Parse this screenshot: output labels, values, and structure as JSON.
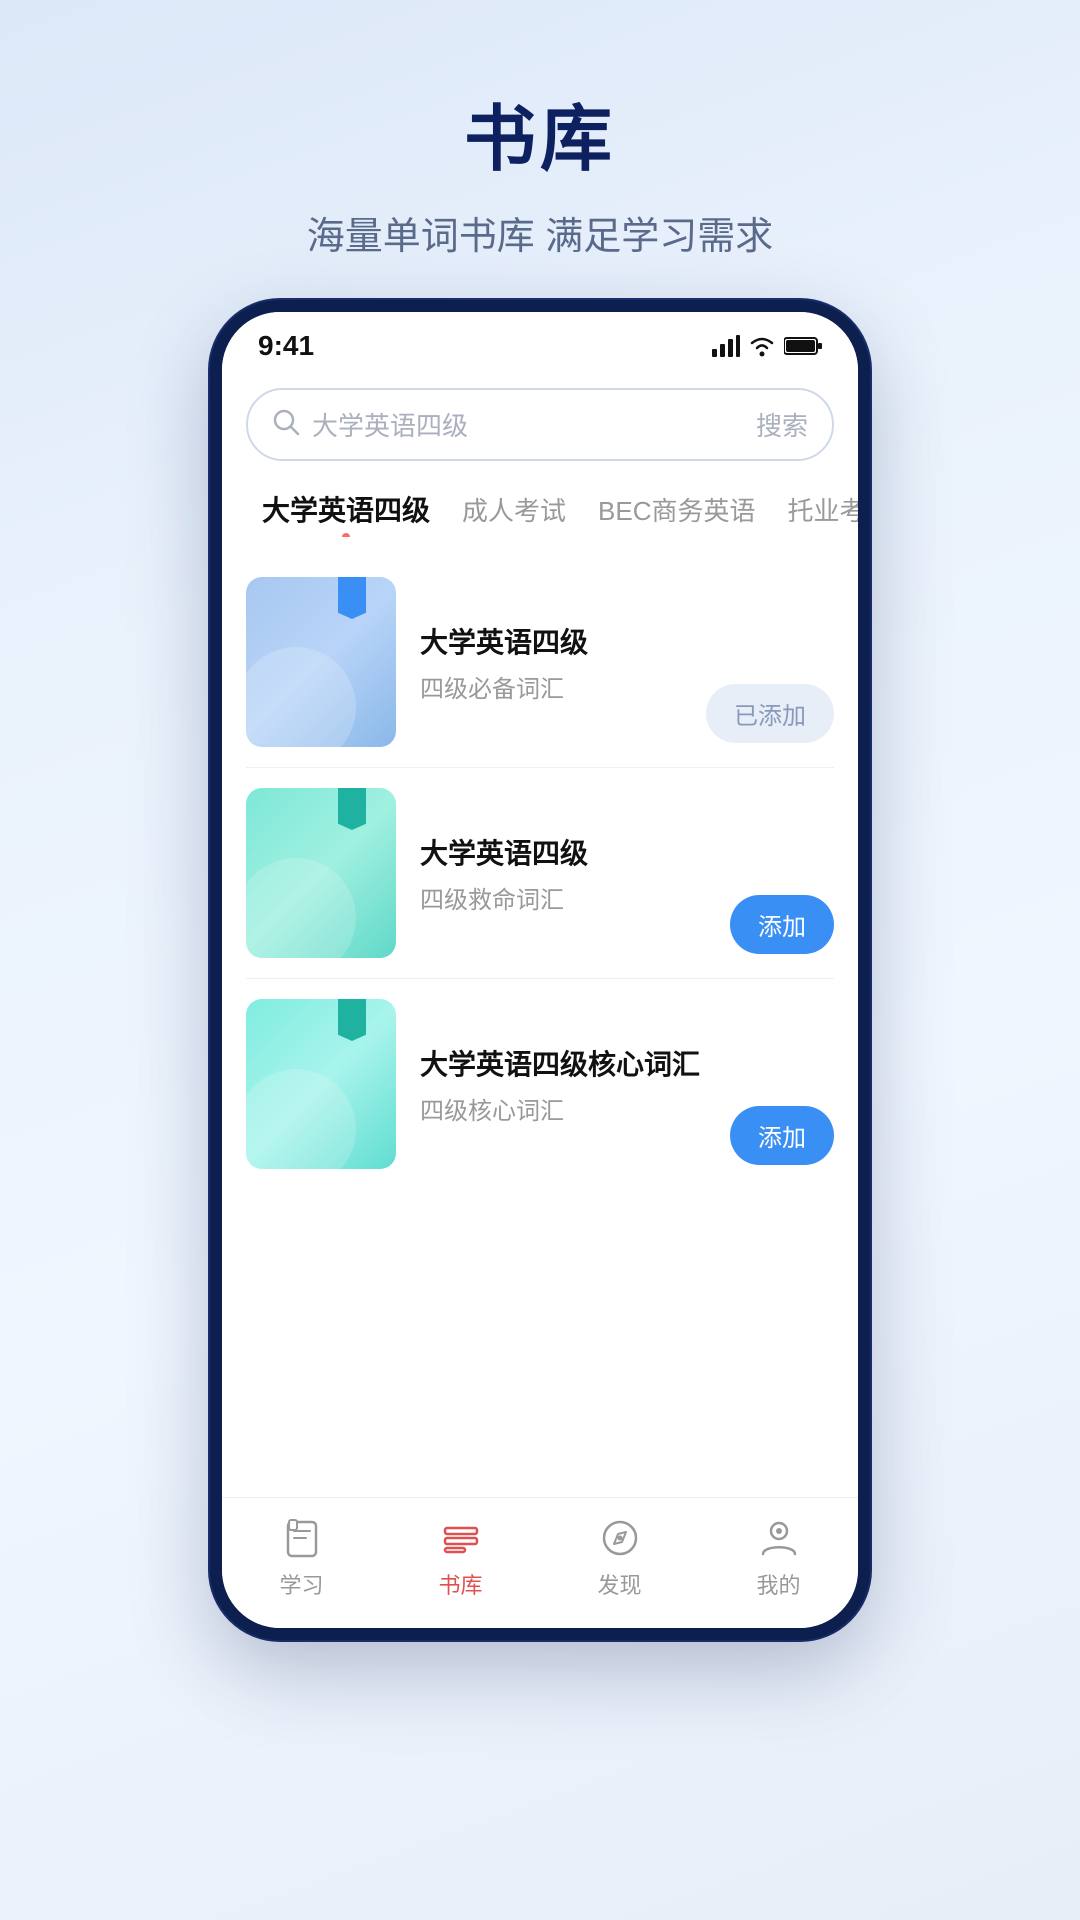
{
  "header": {
    "title": "书库",
    "subtitle": "海量单词书库 满足学习需求"
  },
  "phone": {
    "status_bar": {
      "time": "9:41"
    },
    "search": {
      "placeholder": "大学英语四级",
      "button": "搜索"
    },
    "categories": [
      {
        "id": "cat1",
        "label": "大学英语四级",
        "active": true
      },
      {
        "id": "cat2",
        "label": "成人考试",
        "active": false
      },
      {
        "id": "cat3",
        "label": "BEC商务英语",
        "active": false
      },
      {
        "id": "cat4",
        "label": "托业考试A",
        "active": false
      }
    ],
    "books": [
      {
        "id": "book1",
        "name": "大学英语四级",
        "desc": "四级必备词汇",
        "cover_style": "1",
        "action": "已添加",
        "action_type": "added"
      },
      {
        "id": "book2",
        "name": "大学英语四级",
        "desc": "四级救命词汇",
        "cover_style": "2",
        "action": "添加",
        "action_type": "add"
      },
      {
        "id": "book3",
        "name": "大学英语四级核心词汇",
        "desc": "四级核心词汇",
        "cover_style": "3",
        "action": "添加",
        "action_type": "add"
      }
    ],
    "nav": [
      {
        "id": "nav-study",
        "label": "学习",
        "active": false
      },
      {
        "id": "nav-library",
        "label": "书库",
        "active": true
      },
      {
        "id": "nav-discover",
        "label": "发现",
        "active": false
      },
      {
        "id": "nav-mine",
        "label": "我的",
        "active": false
      }
    ]
  }
}
